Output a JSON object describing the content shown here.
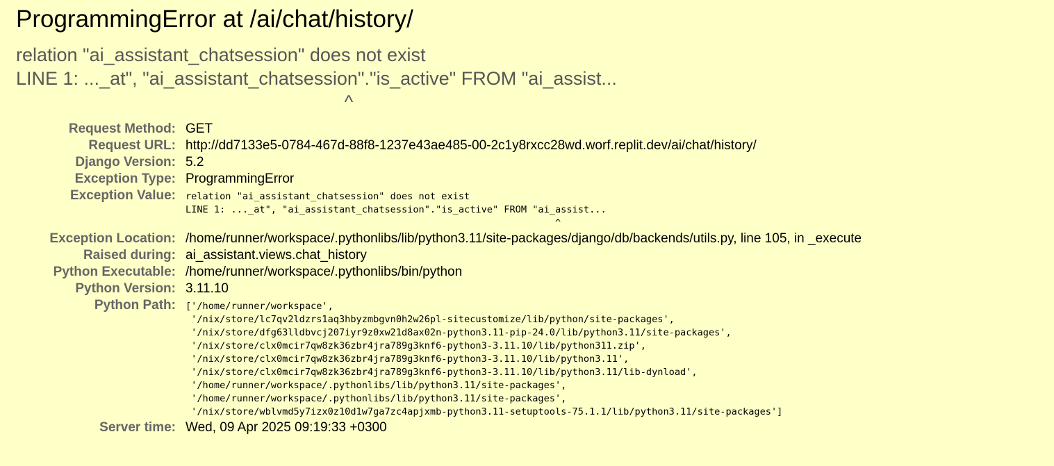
{
  "title": "ProgrammingError at /ai/chat/history/",
  "exception_value_header": "relation \"ai_assistant_chatsession\" does not exist\nLINE 1: ..._at\", \"ai_assistant_chatsession\".\"is_active\" FROM \"ai_assist...\n                                                               ^",
  "meta": {
    "request_method_label": "Request Method:",
    "request_method": "GET",
    "request_url_label": "Request URL:",
    "request_url": "http://dd7133e5-0784-467d-88f8-1237e43ae485-00-2c1y8rxcc28wd.worf.replit.dev/ai/chat/history/",
    "django_version_label": "Django Version:",
    "django_version": "5.2",
    "exception_type_label": "Exception Type:",
    "exception_type": "ProgrammingError",
    "exception_value_label": "Exception Value:",
    "exception_value": "relation \"ai_assistant_chatsession\" does not exist\nLINE 1: ..._at\", \"ai_assistant_chatsession\".\"is_active\" FROM \"ai_assist...\n                                                                 ^",
    "exception_location_label": "Exception Location:",
    "exception_location": "/home/runner/workspace/.pythonlibs/lib/python3.11/site-packages/django/db/backends/utils.py, line 105, in _execute",
    "raised_during_label": "Raised during:",
    "raised_during": "ai_assistant.views.chat_history",
    "python_executable_label": "Python Executable:",
    "python_executable": "/home/runner/workspace/.pythonlibs/bin/python",
    "python_version_label": "Python Version:",
    "python_version": "3.11.10",
    "python_path_label": "Python Path:",
    "python_path": "['/home/runner/workspace',\n '/nix/store/lc7qv2ldzrs1aq3hbyzmbgvn0h2w26pl-sitecustomize/lib/python/site-packages',\n '/nix/store/dfg63lldbvcj207iyr9z0xw21d8ax02n-python3.11-pip-24.0/lib/python3.11/site-packages',\n '/nix/store/clx0mcir7qw8zk36zbr4jra789g3knf6-python3-3.11.10/lib/python311.zip',\n '/nix/store/clx0mcir7qw8zk36zbr4jra789g3knf6-python3-3.11.10/lib/python3.11',\n '/nix/store/clx0mcir7qw8zk36zbr4jra789g3knf6-python3-3.11.10/lib/python3.11/lib-dynload',\n '/home/runner/workspace/.pythonlibs/lib/python3.11/site-packages',\n '/home/runner/workspace/.pythonlibs/lib/python3.11/site-packages',\n '/nix/store/wblvmd5y7izx0z10d1w7ga7zc4apjxmb-python3.11-setuptools-75.1.1/lib/python3.11/site-packages']",
    "server_time_label": "Server time:",
    "server_time": "Wed, 09 Apr 2025 09:19:33 +0300"
  }
}
